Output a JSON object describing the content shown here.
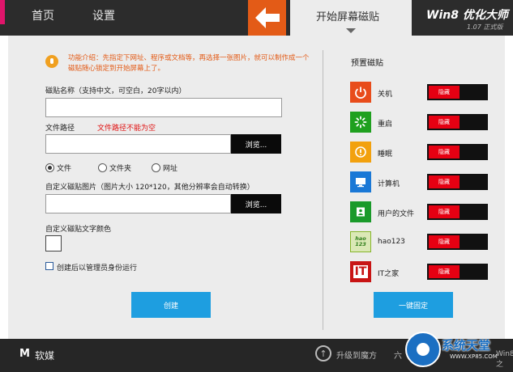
{
  "header": {
    "nav_home": "首页",
    "nav_settings": "设置",
    "active_tab": "开始屏幕磁贴",
    "brand_name": "Win8 优化大师",
    "brand_version": "1.07 正式版"
  },
  "form": {
    "info_text": "功能介绍：先指定下网址、程序或文档等，再选择一张图片，就可以制作成一个磁贴随心锁定到开始屏幕上了。",
    "name_label": "磁贴名称（支持中文，可空白，20字以内）",
    "name_value": "",
    "path_label": "文件路径",
    "path_error": "文件路径不能为空",
    "path_value": "",
    "browse_label": "浏览...",
    "radio_file": "文件",
    "radio_folder": "文件夹",
    "radio_url": "网址",
    "selected_type": "文件",
    "image_label": "自定义磁贴图片（图片大小 120*120，其他分辨率会自动转换）",
    "image_value": "",
    "image_browse_label": "浏览...",
    "text_color_label": "自定义磁贴文字颜色",
    "text_color_value": "#ffffff",
    "admin_checkbox_label": "创建后以管理员身份运行",
    "admin_checked": false,
    "create_button": "创建"
  },
  "presets": {
    "title": "预置磁贴",
    "items": [
      {
        "label": "关机",
        "icon": "power-icon",
        "color": "#e84c1b",
        "toggle": "隐藏"
      },
      {
        "label": "重启",
        "icon": "restart-icon",
        "color": "#1fa01f",
        "toggle": "隐藏"
      },
      {
        "label": "睡眠",
        "icon": "sleep-icon",
        "color": "#f2a10e",
        "toggle": "隐藏"
      },
      {
        "label": "计算机",
        "icon": "computer-icon",
        "color": "#1a78d6",
        "toggle": "隐藏"
      },
      {
        "label": "用户的文件",
        "icon": "user-files-icon",
        "color": "#1a9a2a",
        "toggle": "隐藏"
      },
      {
        "label": "hao123",
        "icon": "hao123-icon",
        "color": "#86b52a",
        "icon_text": "hao 123",
        "toggle": "隐藏"
      },
      {
        "label": "IT之家",
        "icon": "ithome-icon",
        "color": "#c81414",
        "icon_text": "IT",
        "toggle": "隐藏"
      }
    ],
    "pin_all_button": "一键固定"
  },
  "footer": {
    "logo_mark": "M",
    "logo_text": "软媒",
    "upgrade_text": "升级到魔方",
    "upgrade_more": "六",
    "watermark_text": "系统天堂",
    "watermark_url": "WWW.XP85.COM",
    "tail_text": "Win8之"
  },
  "colors": {
    "accent_orange": "#e35b17",
    "accent_blue": "#1e9ee0",
    "toggle_red": "#e60012",
    "topbar": "#2c2c2c"
  }
}
